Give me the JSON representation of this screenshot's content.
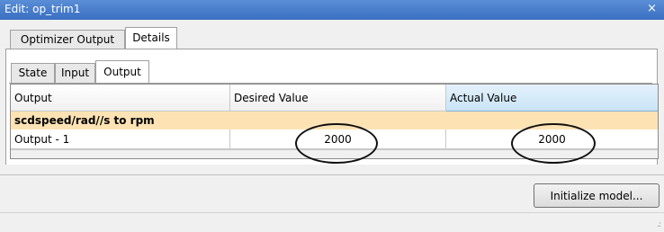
{
  "window": {
    "title": "Edit: op_trim1",
    "close_glyph": "×"
  },
  "tabs": [
    {
      "label": "Optimizer Output",
      "active": false
    },
    {
      "label": "Details",
      "active": true
    }
  ],
  "subtabs": [
    {
      "label": "State",
      "active": false
    },
    {
      "label": "Input",
      "active": false
    },
    {
      "label": "Output",
      "active": true
    }
  ],
  "table": {
    "columns": [
      "Output",
      "Desired Value",
      "Actual Value"
    ],
    "group_label": "scdspeed/rad//s to rpm",
    "rows": [
      {
        "output": "Output - 1",
        "desired_value": "2000",
        "actual_value": "2000"
      }
    ]
  },
  "buttons": {
    "initialize": "Initialize model..."
  },
  "status": {
    "grip_glyph": ".:"
  },
  "colors": {
    "title_bar": "#3a6fc2",
    "group_row": "#fde3b4",
    "sorted_header": "#c9e4f7"
  },
  "annotations": {
    "circled_cells": [
      "desired_value",
      "actual_value"
    ]
  }
}
